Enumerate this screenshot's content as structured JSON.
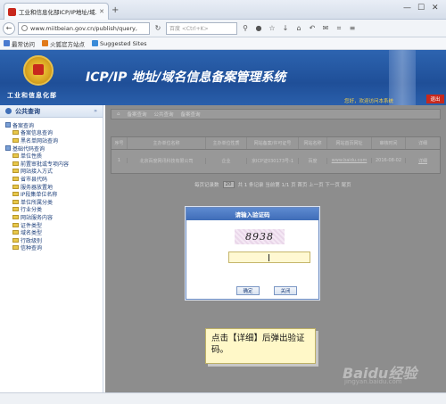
{
  "browser": {
    "tab_title": "工业和信息化部ICP/IP地址/域...",
    "url": "www.miitbeian.gov.cn/publish/query,",
    "search_placeholder": "百度 <Ctrl+K>",
    "bookmarks": [
      {
        "label": "最常访问",
        "color": "#4a7bd0"
      },
      {
        "label": "火狐官方站点",
        "color": "#e07a1a"
      },
      {
        "label": "Suggested Sites",
        "color": "#3a8bd8"
      }
    ]
  },
  "header": {
    "ministry": "工业和信息化部",
    "title": "ICP/IP 地址/域名信息备案管理系统",
    "welcome": "您好，欢迎访问本系统",
    "exit_label": "退出"
  },
  "sidebar": {
    "title": "公共查询",
    "items": [
      {
        "label": "备案查询",
        "level": 1
      },
      {
        "label": "备案信息查询",
        "level": 2
      },
      {
        "label": "黑名单网站查询",
        "level": 2
      },
      {
        "label": "基础代码查询",
        "level": 1
      },
      {
        "label": "单位性质",
        "level": 2
      },
      {
        "label": "前置审批或专项内容",
        "level": 2
      },
      {
        "label": "网站接入方式",
        "level": 2
      },
      {
        "label": "省市县代码",
        "level": 2
      },
      {
        "label": "服务器放置地",
        "level": 2
      },
      {
        "label": "IP段集单位名称",
        "level": 2
      },
      {
        "label": "单位所属分类",
        "level": 2
      },
      {
        "label": "行业分类",
        "level": 2
      },
      {
        "label": "网站服务内容",
        "level": 2
      },
      {
        "label": "证件类型",
        "level": 2
      },
      {
        "label": "域名类型",
        "level": 2
      },
      {
        "label": "行政级别",
        "level": 2
      },
      {
        "label": "信种查询",
        "level": 2
      }
    ]
  },
  "main": {
    "breadcrumb": [
      "备案查询",
      "公共查询",
      "备案查询"
    ],
    "columns": [
      "序号",
      "主办单位名称",
      "主办单位性质",
      "网站备案/许可证号",
      "网站名称",
      "网站首页网址",
      "审核时间",
      "详细"
    ],
    "rows": [
      [
        "1",
        "北京百度网讯科技有限公司",
        "企业",
        "京ICP证030173号-1",
        "百度",
        "www.baidu.com",
        "2016-08-02",
        "详细"
      ]
    ],
    "pager": {
      "per_page_label": "每页记录数",
      "per_page_value": "20",
      "summary": "共 1 条记录  当前第 1/1 页  首页  上一页  下一页  尾页"
    }
  },
  "dialog": {
    "title": "请输入验证码",
    "captcha_text": "8938",
    "ok_label": "确定",
    "close_label": "关闭"
  },
  "callout": {
    "text": "点击【详细】后弹出验证码。"
  },
  "watermark": {
    "brand": "Baidu经验",
    "url": "jingyan.baidu.com"
  }
}
